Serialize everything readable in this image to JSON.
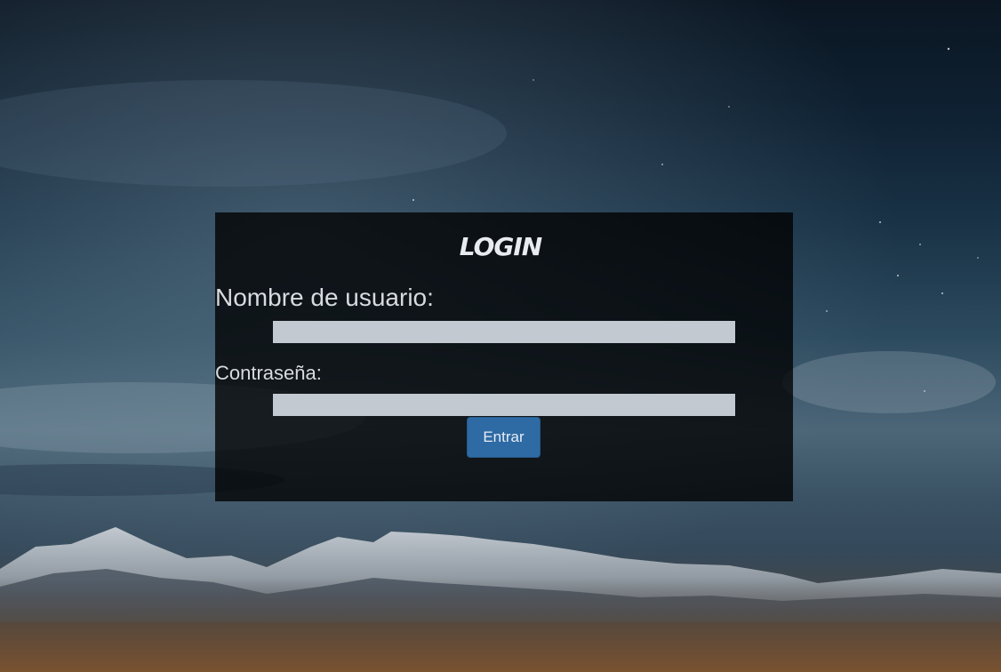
{
  "login": {
    "title": "LOGIN",
    "username_label": "Nombre de usuario:",
    "username_value": "",
    "password_label": "Contraseña:",
    "password_value": "",
    "submit_label": "Entrar"
  },
  "colors": {
    "panel_background": "#000000",
    "input_background": "#c3c9d1",
    "button_background": "#2e6aa3",
    "text": "#d7dbe0"
  }
}
